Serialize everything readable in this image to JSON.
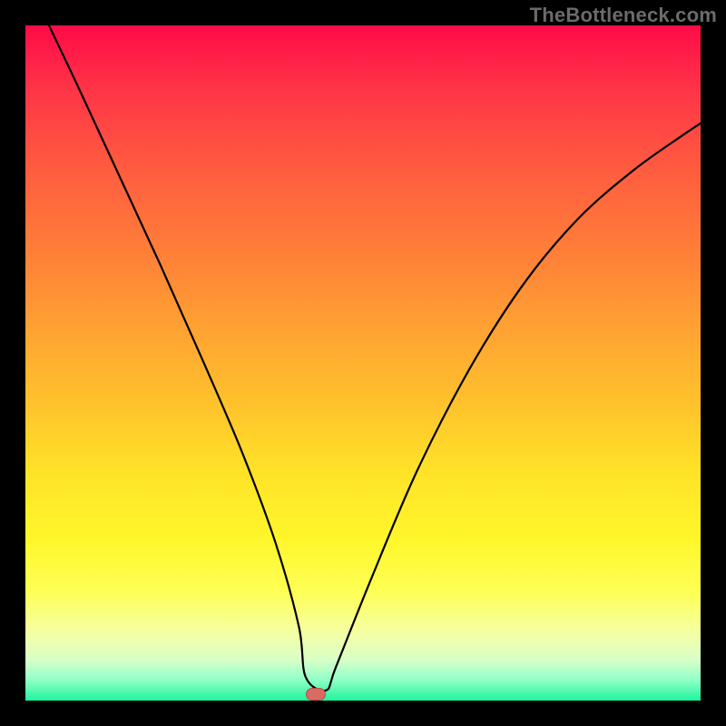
{
  "watermark": "TheBottleneck.com",
  "marker": {
    "fill": "#d86b63",
    "stroke": "#b24f48",
    "cx_frac": 0.43,
    "cy_frac": 0.99
  },
  "gradient_stops": [
    {
      "pos": 0.0,
      "color": "#ff0b47"
    },
    {
      "pos": 0.1,
      "color": "#ff3647"
    },
    {
      "pos": 0.22,
      "color": "#ff5e3f"
    },
    {
      "pos": 0.34,
      "color": "#ff8038"
    },
    {
      "pos": 0.45,
      "color": "#ffa232"
    },
    {
      "pos": 0.56,
      "color": "#ffc22c"
    },
    {
      "pos": 0.66,
      "color": "#ffe228"
    },
    {
      "pos": 0.76,
      "color": "#fff62a"
    },
    {
      "pos": 0.84,
      "color": "#feff56"
    },
    {
      "pos": 0.9,
      "color": "#f5ffa4"
    },
    {
      "pos": 0.94,
      "color": "#d8ffc8"
    },
    {
      "pos": 0.97,
      "color": "#8effc8"
    },
    {
      "pos": 1.0,
      "color": "#1ef59c"
    }
  ],
  "chart_data": {
    "type": "line",
    "title": "",
    "xlabel": "",
    "ylabel": "",
    "xlim": [
      0,
      1
    ],
    "ylim": [
      0,
      1
    ],
    "series": [
      {
        "name": "curve",
        "x": [
          0.035,
          0.08,
          0.14,
          0.2,
          0.26,
          0.32,
          0.37,
          0.405,
          0.415,
          0.445,
          0.46,
          0.51,
          0.58,
          0.66,
          0.74,
          0.82,
          0.9,
          0.97,
          1.0
        ],
        "y": [
          1.0,
          0.905,
          0.775,
          0.645,
          0.51,
          0.37,
          0.235,
          0.11,
          0.035,
          0.015,
          0.05,
          0.175,
          0.34,
          0.495,
          0.62,
          0.715,
          0.785,
          0.835,
          0.855
        ]
      }
    ],
    "annotations": [
      {
        "type": "marker",
        "x": 0.43,
        "y": 0.01,
        "shape": "pill",
        "fill": "#d86b63",
        "stroke": "#b24f48"
      }
    ]
  }
}
